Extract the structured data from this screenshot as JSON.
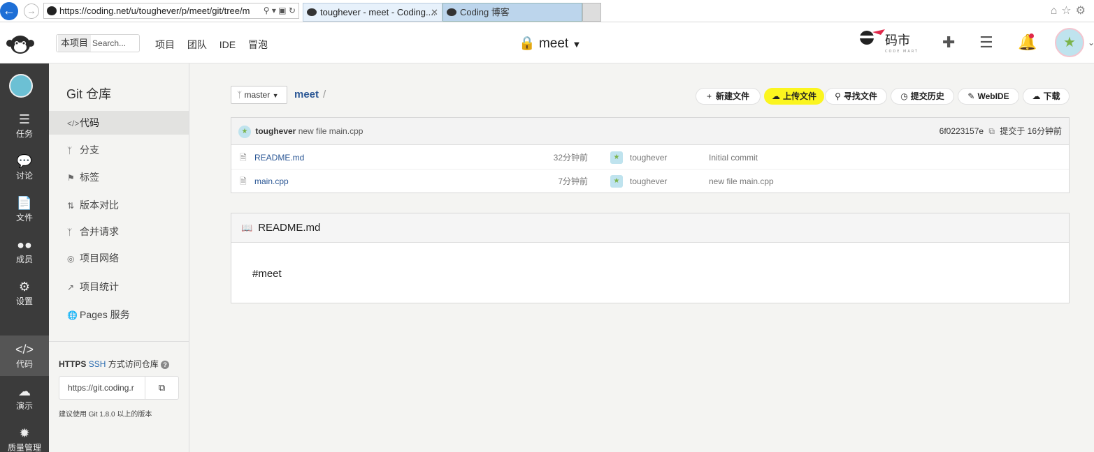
{
  "browser": {
    "url": "https://coding.net/u/toughever/p/meet/git/tree/m",
    "tabs": [
      {
        "title": "toughever - meet - Coding....",
        "active": true
      },
      {
        "title": "Coding 博客",
        "active": false
      }
    ]
  },
  "header": {
    "search_scope": "本项目",
    "search_placeholder": "Search...",
    "nav": [
      "项目",
      "团队",
      "IDE",
      "冒泡"
    ],
    "project_name": "meet",
    "mashi_label": "码市",
    "mashi_sub": "CODE MART"
  },
  "darknav": {
    "items": [
      {
        "label": "任务",
        "icon": "task-icon"
      },
      {
        "label": "讨论",
        "icon": "discussion-icon"
      },
      {
        "label": "文件",
        "icon": "file-icon"
      },
      {
        "label": "成员",
        "icon": "members-icon"
      },
      {
        "label": "设置",
        "icon": "settings-icon"
      },
      {
        "label": "代码",
        "icon": "code-icon",
        "active": true
      },
      {
        "label": "演示",
        "icon": "cloud-icon"
      },
      {
        "label": "质量管理",
        "icon": "quality-icon"
      }
    ]
  },
  "sidebar": {
    "title": "Git 仓库",
    "items": [
      {
        "label": "代码",
        "icon": "code-icon",
        "active": true
      },
      {
        "label": "分支",
        "icon": "branch-icon"
      },
      {
        "label": "标签",
        "icon": "tag-icon"
      },
      {
        "label": "版本对比",
        "icon": "compare-icon"
      },
      {
        "label": "合并请求",
        "icon": "merge-request-icon"
      },
      {
        "label": "项目网络",
        "icon": "network-icon"
      },
      {
        "label": "项目统计",
        "icon": "stats-icon"
      },
      {
        "label": "Pages 服务",
        "icon": "pages-icon"
      }
    ],
    "clone_https": "HTTPS",
    "clone_ssh": "SSH",
    "clone_rest": "方式访问仓库",
    "clone_url": "https://git.coding.r",
    "clone_tip": "建议使用 Git 1.8.0 以上的版本"
  },
  "repo": {
    "branch": "master",
    "name": "meet",
    "actions": [
      "新建文件",
      "上传文件",
      "寻找文件",
      "提交历史",
      "WebIDE",
      "下载"
    ],
    "last_commit": {
      "user": "toughever",
      "message": "new file main.cpp",
      "hash": "6f0223157e",
      "time": "提交于 16分钟前"
    },
    "files": [
      {
        "name": "README.md",
        "time": "32分钟前",
        "user": "toughever",
        "message": "Initial commit"
      },
      {
        "name": "main.cpp",
        "time": "7分钟前",
        "user": "toughever",
        "message": "new file main.cpp"
      }
    ],
    "readme_title": "README.md",
    "readme_content": "#meet"
  },
  "colors": {
    "accent": "#2b5795",
    "highlight": "#fbf51f",
    "dark_nav": "#3b3b3b"
  }
}
